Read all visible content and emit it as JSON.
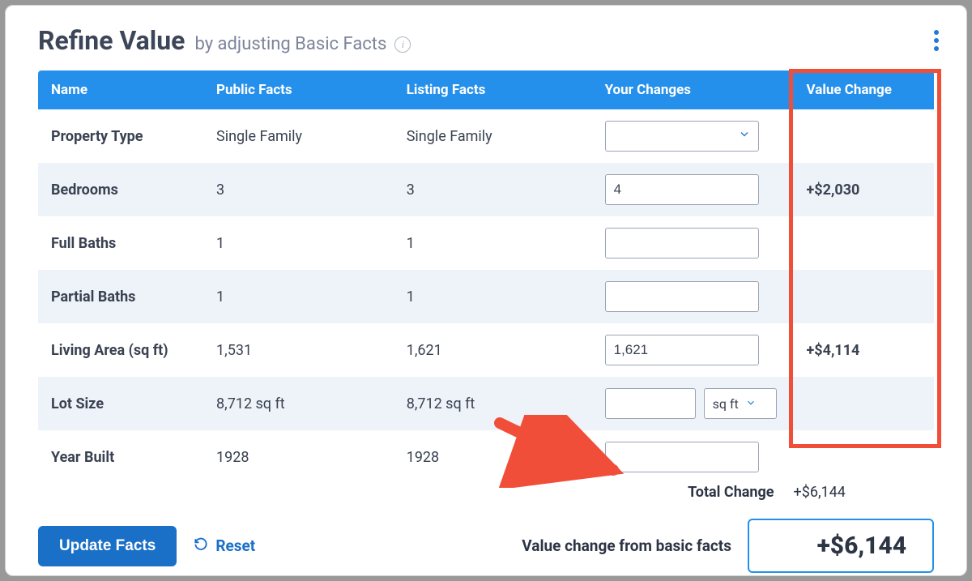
{
  "header": {
    "title": "Refine Value",
    "subtitle": "by adjusting Basic Facts"
  },
  "columns": {
    "name": "Name",
    "public": "Public Facts",
    "listing": "Listing Facts",
    "changes": "Your Changes",
    "valchange": "Value Change"
  },
  "rows": [
    {
      "label": "Property Type",
      "public": "Single Family",
      "listing": "Single Family",
      "input_kind": "select",
      "value": "",
      "valchange": ""
    },
    {
      "label": "Bedrooms",
      "public": "3",
      "listing": "3",
      "input_kind": "text",
      "value": "4",
      "valchange": "+$2,030"
    },
    {
      "label": "Full Baths",
      "public": "1",
      "listing": "1",
      "input_kind": "text",
      "value": "",
      "valchange": ""
    },
    {
      "label": "Partial Baths",
      "public": "1",
      "listing": "1",
      "input_kind": "text",
      "value": "",
      "valchange": ""
    },
    {
      "label": "Living Area (sq ft)",
      "public": "1,531",
      "listing": "1,621",
      "input_kind": "text",
      "value": "1,621",
      "valchange": "+$4,114"
    },
    {
      "label": "Lot Size",
      "public": "8,712 sq ft",
      "listing": "8,712 sq ft",
      "input_kind": "unit",
      "value": "",
      "unit": "sq ft",
      "valchange": ""
    },
    {
      "label": "Year Built",
      "public": "1928",
      "listing": "1928",
      "input_kind": "text",
      "value": "",
      "valchange": ""
    }
  ],
  "total": {
    "label": "Total Change",
    "value": "+$6,144"
  },
  "footer": {
    "update": "Update Facts",
    "reset": "Reset",
    "label": "Value change from basic facts",
    "value": "+$6,144"
  }
}
